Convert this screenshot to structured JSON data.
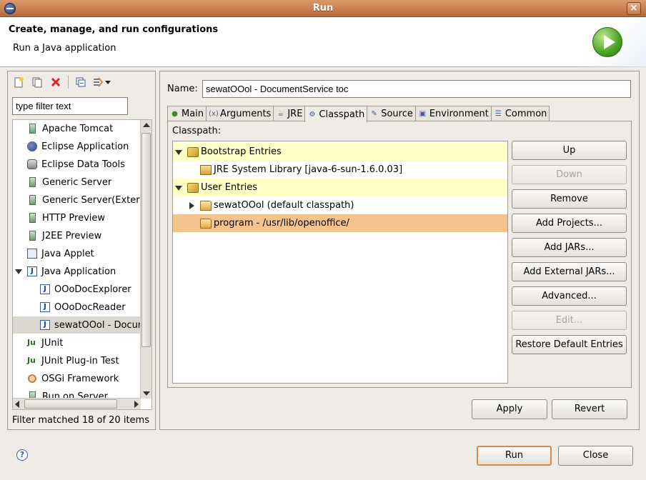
{
  "window": {
    "title": "Run"
  },
  "header": {
    "title": "Create, manage, and run configurations",
    "subtitle": "Run a Java application"
  },
  "left": {
    "filter_placeholder": "type filter text",
    "filter_value": "type filter text",
    "status": "Filter matched 18 of 20 items",
    "tree": [
      {
        "label": "Apache Tomcat",
        "icon": "server-icon",
        "indent": 0
      },
      {
        "label": "Eclipse Application",
        "icon": "eclipse-icon",
        "indent": 0
      },
      {
        "label": "Eclipse Data Tools",
        "icon": "database-icon",
        "indent": 0
      },
      {
        "label": "Generic Server",
        "icon": "server-icon",
        "indent": 0
      },
      {
        "label": "Generic Server(Extern",
        "icon": "server-icon",
        "indent": 0
      },
      {
        "label": "HTTP Preview",
        "icon": "server-icon",
        "indent": 0
      },
      {
        "label": "J2EE Preview",
        "icon": "server-icon",
        "indent": 0
      },
      {
        "label": "Java Applet",
        "icon": "applet-icon",
        "indent": 0
      },
      {
        "label": "Java Application",
        "icon": "java-app-icon",
        "indent": 0,
        "expanded": true
      },
      {
        "label": "OOoDocExplorer",
        "icon": "java-app-icon",
        "indent": 1
      },
      {
        "label": "OOoDocReader",
        "icon": "java-app-icon",
        "indent": 1
      },
      {
        "label": "sewatOOol - Docur",
        "icon": "java-app-icon",
        "indent": 1,
        "selected": true
      },
      {
        "label": "JUnit",
        "icon": "junit-icon",
        "indent": 0
      },
      {
        "label": "JUnit Plug-in Test",
        "icon": "junit-icon",
        "indent": 0
      },
      {
        "label": "OSGi Framework",
        "icon": "osgi-icon",
        "indent": 0
      },
      {
        "label": "Run on Server",
        "icon": "server-icon",
        "indent": 0
      }
    ]
  },
  "right": {
    "name_label": "Name:",
    "name_value": "sewatOOol - DocumentService toc",
    "tabs": [
      {
        "label": "Main",
        "icon": "main-tab-icon"
      },
      {
        "label": "Arguments",
        "icon": "arguments-tab-icon"
      },
      {
        "label": "JRE",
        "icon": "jre-tab-icon"
      },
      {
        "label": "Classpath",
        "icon": "classpath-tab-icon",
        "active": true
      },
      {
        "label": "Source",
        "icon": "source-tab-icon"
      },
      {
        "label": "Environment",
        "icon": "environment-tab-icon"
      },
      {
        "label": "Common",
        "icon": "common-tab-icon"
      }
    ],
    "classpath_label": "Classpath:",
    "classpath": [
      {
        "label": "Bootstrap Entries",
        "level": 0,
        "twisty": "open",
        "icon": "bundle",
        "style": "hl"
      },
      {
        "label": "JRE System Library [java-6-sun-1.6.0.03]",
        "level": 1,
        "twisty": "none",
        "icon": "jar",
        "style": ""
      },
      {
        "label": "User Entries",
        "level": 0,
        "twisty": "open",
        "icon": "bundle",
        "style": "hl"
      },
      {
        "label": "sewatOOol (default classpath)",
        "level": 1,
        "twisty": "closed",
        "icon": "folder",
        "style": ""
      },
      {
        "label": "program - /usr/lib/openoffice/",
        "level": 1,
        "twisty": "none",
        "icon": "folder",
        "style": "sel"
      }
    ],
    "buttons": [
      {
        "label": "Up",
        "enabled": true
      },
      {
        "label": "Down",
        "enabled": false
      },
      {
        "label": "Remove",
        "enabled": true
      },
      {
        "label": "Add Projects...",
        "enabled": true
      },
      {
        "label": "Add JARs...",
        "enabled": true
      },
      {
        "label": "Add External JARs...",
        "enabled": true
      },
      {
        "label": "Advanced...",
        "enabled": true
      },
      {
        "label": "Edit...",
        "enabled": false
      },
      {
        "label": "Restore Default Entries",
        "enabled": true
      }
    ],
    "apply": "Apply",
    "revert": "Revert"
  },
  "footer": {
    "help": "?",
    "run": "Run",
    "close": "Close"
  },
  "colors": {
    "accent": "#d68a4a",
    "highlight_row": "#ffffc8",
    "selected_row": "#f4c48e"
  }
}
